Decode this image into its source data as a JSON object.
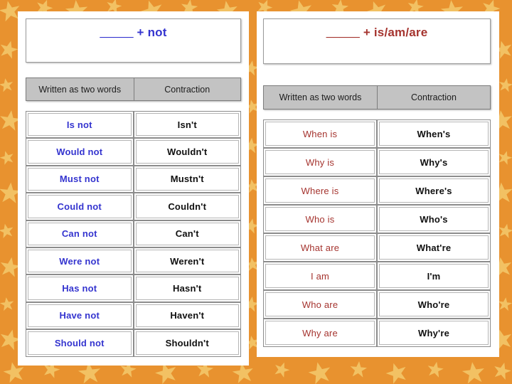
{
  "background": {
    "name": "orange-star-border",
    "base_color": "#e8922f",
    "star_color": "#f2c163"
  },
  "panels": [
    {
      "id": "left",
      "title": {
        "blank": "_____",
        "suffix": " + not",
        "color": "#3434cf"
      },
      "columns": [
        "Written as two words",
        "Contraction"
      ],
      "rows": [
        {
          "two_words": "Is not",
          "contraction": "Isn't"
        },
        {
          "two_words": "Would not",
          "contraction": "Wouldn't"
        },
        {
          "two_words": "Must not",
          "contraction": "Mustn't"
        },
        {
          "two_words": "Could not",
          "contraction": "Couldn't"
        },
        {
          "two_words": "Can not",
          "contraction": "Can't"
        },
        {
          "two_words": "Were not",
          "contraction": "Weren't"
        },
        {
          "two_words": "Has not",
          "contraction": "Hasn't"
        },
        {
          "two_words": "Have not",
          "contraction": "Haven't"
        },
        {
          "two_words": "Should not",
          "contraction": "Shouldn't"
        }
      ]
    },
    {
      "id": "right",
      "title": {
        "blank": "_____",
        "suffix": " + is/am/are",
        "color": "#a5342f"
      },
      "columns": [
        "Written as two words",
        "Contraction"
      ],
      "rows": [
        {
          "two_words": "When is",
          "contraction": "When's"
        },
        {
          "two_words": "Why is",
          "contraction": "Why's"
        },
        {
          "two_words": "Where is",
          "contraction": "Where's"
        },
        {
          "two_words": "Who is",
          "contraction": "Who's"
        },
        {
          "two_words": "What are",
          "contraction": "What're"
        },
        {
          "two_words": "I am",
          "contraction": "I'm"
        },
        {
          "two_words": "Who are",
          "contraction": "Who're"
        },
        {
          "two_words": "Why are",
          "contraction": "Why're"
        }
      ]
    }
  ]
}
